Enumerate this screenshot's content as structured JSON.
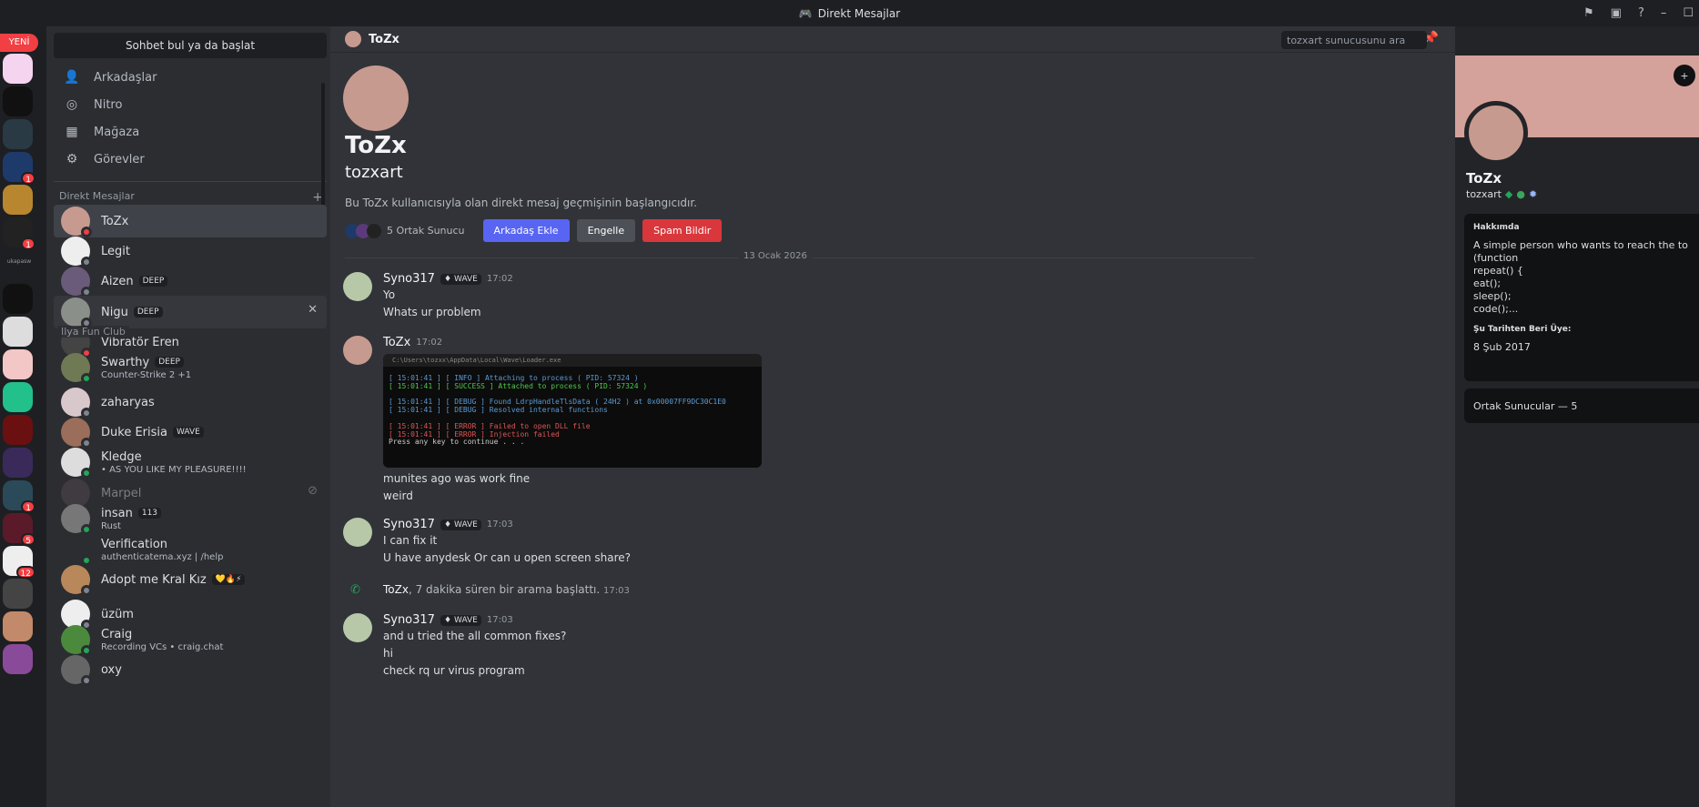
{
  "titlebar": {
    "title": "Direkt Mesajlar"
  },
  "servers": {
    "new_label": "YENİ",
    "badges": [
      "1",
      "1",
      "1",
      "5",
      "12"
    ],
    "text_server": "ukapasw"
  },
  "sidebar": {
    "search_label": "Sohbet bul ya da başlat",
    "nav": [
      {
        "label": "Arkadaşlar"
      },
      {
        "label": "Nitro"
      },
      {
        "label": "Mağaza"
      },
      {
        "label": "Görevler"
      }
    ],
    "dm_header": "Direkt Mesajlar",
    "dm_add": "+",
    "dms": [
      {
        "name": "ToZx",
        "sub": "",
        "tag": "",
        "color": "#c79a8f",
        "status": "#f23f43"
      },
      {
        "name": "Legit",
        "sub": "",
        "tag": "",
        "color": "#eeeeee",
        "status": "#80848e"
      },
      {
        "name": "Aizen",
        "sub": "",
        "tag": "DEEP",
        "color": "#6b5b7a",
        "status": "#80848e"
      },
      {
        "name": "Nigu",
        "sub": "",
        "tag": "DEEP",
        "color": "#8a8f8a",
        "status": "#80848e"
      },
      {
        "name": "Vibratör Eren",
        "sub": "",
        "tag": "",
        "color": "#444",
        "status": "#f23f43"
      },
      {
        "name": "Swarthy",
        "sub": "Counter-Strike 2 +1",
        "tag": "DEEP",
        "color": "#6f7a55",
        "status": "#23a55a"
      },
      {
        "name": "zaharyas",
        "sub": "",
        "tag": "",
        "color": "#d8c8cc",
        "status": "#80848e"
      },
      {
        "name": "Duke Erisia",
        "sub": "",
        "tag": "WAVE",
        "color": "#9a6e5a",
        "status": "#80848e"
      },
      {
        "name": "Kledge",
        "sub": "• AS YOU LIKE MY PLEASURE!!!!",
        "tag": "",
        "color": "#dddddd",
        "status": "#23a55a"
      },
      {
        "name": "Marpel",
        "sub": "",
        "tag": "",
        "color": "#5a4a55",
        "status": ""
      },
      {
        "name": "insan",
        "sub": "Rust",
        "tag": "113",
        "color": "#777",
        "status": "#23a55a"
      },
      {
        "name": "Verification",
        "sub": "authenticatema.xyz | /help",
        "tag": "",
        "color": "#2b2d31",
        "status": "#23a55a"
      },
      {
        "name": "Adopt me Kral Kız",
        "sub": "",
        "tag": "💛🔥⚡",
        "color": "#b8875a",
        "status": "#80848e"
      },
      {
        "name": "üzüm",
        "sub": "",
        "tag": "",
        "color": "#eeeeee",
        "status": "#80848e"
      },
      {
        "name": "Craig",
        "sub": "Recording VCs • craig.chat",
        "tag": "",
        "color": "#4b8a3c",
        "status": "#23a55a"
      },
      {
        "name": "oxy",
        "sub": "",
        "tag": "",
        "color": "#666",
        "status": "#80848e"
      }
    ],
    "drag_ghost": "Ilya Fun Club"
  },
  "channel": {
    "name": "ToZx",
    "search_placeholder": "tozxart sunucusunu ara"
  },
  "intro": {
    "display_name": "ToZx",
    "username": "tozxart",
    "text": "Bu ToZx kullanıcısıyla olan direkt mesaj geçmişinin başlangıcıdır.",
    "mutual": "5 Ortak Sunucu",
    "add_friend": "Arkadaş Ekle",
    "block": "Engelle",
    "report": "Spam Bildir"
  },
  "date_divider": "13 Ocak 2026",
  "messages": [
    {
      "author": "Syno317",
      "tag": "WAVE",
      "time": "17:02",
      "lines": [
        "Yo",
        "Whats ur problem"
      ]
    },
    {
      "author": "ToZx",
      "tag": "",
      "time": "17:02",
      "lines": [
        "munites ago was work fine",
        "weird"
      ]
    },
    {
      "author": "Syno317",
      "tag": "WAVE",
      "time": "17:03",
      "lines": [
        "I can fix it",
        "U have anydesk Or can u open screen share?"
      ]
    },
    {
      "author": "Syno317",
      "tag": "WAVE",
      "time": "17:03",
      "lines": [
        "and u tried the all common fixes?",
        "hi",
        "check rq ur virus program"
      ]
    }
  ],
  "call_event": {
    "author": "ToZx",
    "text": ", 7 dakika süren bir arama başlattı.",
    "time": "17:03"
  },
  "console": {
    "title": "C:\\Users\\tozxx\\AppData\\Local\\Wave\\Loader.exe",
    "lines": [
      {
        "text": "[ 15:01:41 ] [ INFO ] Attaching to process ( PID: 57324 )",
        "color": "#5b9bd5"
      },
      {
        "text": "[ 15:01:41 ] [ SUCCESS ] Attached to process ( PID: 57324 )",
        "color": "#4ec94e"
      },
      {
        "text": "[ 15:01:41 ] [ DEBUG ] Found LdrpHandleTlsData ( 24H2 ) at 0x00007FF9DC30C1E0",
        "color": "#5b9bd5"
      },
      {
        "text": "[ 15:01:41 ] [ DEBUG ] Resolved internal functions",
        "color": "#5b9bd5"
      },
      {
        "text": "[ 15:01:41 ] [ ERROR ] Failed to open DLL file",
        "color": "#e05555"
      },
      {
        "text": "[ 15:01:41 ] [ ERROR ] Injection failed",
        "color": "#e05555"
      },
      {
        "text": "Press any key to continue . . .",
        "color": "#cccccc"
      }
    ]
  },
  "profile": {
    "display_name": "ToZx",
    "username": "tozxart",
    "about_title": "Hakkımda",
    "bio": "A simple person who wants to reach the to\n(function\nrepeat() {\neat();\nsleep();\ncode();...",
    "member_since_title": "Şu Tarihten Beri Üye:",
    "member_since": "8 Şub 2017",
    "mutual_servers": "Ortak Sunucular — 5",
    "banner_color": "#d4a29b"
  }
}
